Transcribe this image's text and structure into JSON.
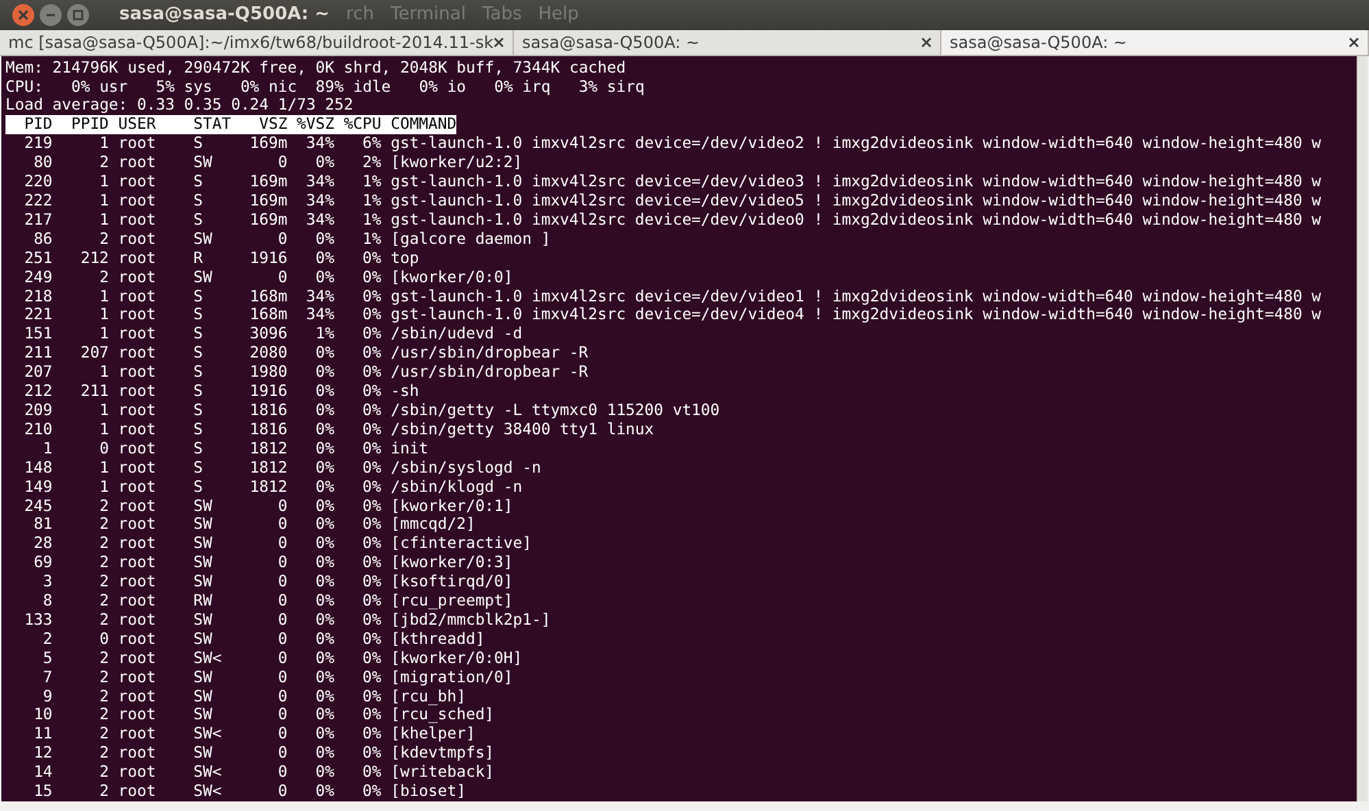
{
  "window": {
    "title": "sasa@sasa-Q500A: ~"
  },
  "menu": [
    "rch",
    "Terminal",
    "Tabs",
    "Help"
  ],
  "tabs": [
    {
      "label": "mc [sasa@sasa-Q500A]:~/imx6/tw68/buildroot-2014.11-sk",
      "selected": false
    },
    {
      "label": "sasa@sasa-Q500A: ~",
      "selected": false
    },
    {
      "label": "sasa@sasa-Q500A: ~",
      "selected": true
    }
  ],
  "summary": [
    "Mem: 214796K used, 290472K free, 0K shrd, 2048K buff, 7344K cached",
    "CPU:   0% usr   5% sys   0% nic  89% idle   0% io   0% irq   3% sirq",
    "Load average: 0.33 0.35 0.24 1/73 252"
  ],
  "table": {
    "columns": [
      "PID",
      "PPID",
      "USER",
      "STAT",
      "VSZ",
      "%VSZ",
      "%CPU",
      "COMMAND"
    ],
    "rows": [
      [
        "219",
        "1",
        "root",
        "S",
        "169m",
        "34%",
        "6%",
        "gst-launch-1.0 imxv4l2src device=/dev/video2 ! imxg2dvideosink window-width=640 window-height=480 w"
      ],
      [
        "80",
        "2",
        "root",
        "SW",
        "0",
        "0%",
        "2%",
        "[kworker/u2:2]"
      ],
      [
        "220",
        "1",
        "root",
        "S",
        "169m",
        "34%",
        "1%",
        "gst-launch-1.0 imxv4l2src device=/dev/video3 ! imxg2dvideosink window-width=640 window-height=480 w"
      ],
      [
        "222",
        "1",
        "root",
        "S",
        "169m",
        "34%",
        "1%",
        "gst-launch-1.0 imxv4l2src device=/dev/video5 ! imxg2dvideosink window-width=640 window-height=480 w"
      ],
      [
        "217",
        "1",
        "root",
        "S",
        "169m",
        "34%",
        "1%",
        "gst-launch-1.0 imxv4l2src device=/dev/video0 ! imxg2dvideosink window-width=640 window-height=480 w"
      ],
      [
        "86",
        "2",
        "root",
        "SW",
        "0",
        "0%",
        "1%",
        "[galcore daemon ]"
      ],
      [
        "251",
        "212",
        "root",
        "R",
        "1916",
        "0%",
        "0%",
        "top"
      ],
      [
        "249",
        "2",
        "root",
        "SW",
        "0",
        "0%",
        "0%",
        "[kworker/0:0]"
      ],
      [
        "218",
        "1",
        "root",
        "S",
        "168m",
        "34%",
        "0%",
        "gst-launch-1.0 imxv4l2src device=/dev/video1 ! imxg2dvideosink window-width=640 window-height=480 w"
      ],
      [
        "221",
        "1",
        "root",
        "S",
        "168m",
        "34%",
        "0%",
        "gst-launch-1.0 imxv4l2src device=/dev/video4 ! imxg2dvideosink window-width=640 window-height=480 w"
      ],
      [
        "151",
        "1",
        "root",
        "S",
        "3096",
        "1%",
        "0%",
        "/sbin/udevd -d"
      ],
      [
        "211",
        "207",
        "root",
        "S",
        "2080",
        "0%",
        "0%",
        "/usr/sbin/dropbear -R"
      ],
      [
        "207",
        "1",
        "root",
        "S",
        "1980",
        "0%",
        "0%",
        "/usr/sbin/dropbear -R"
      ],
      [
        "212",
        "211",
        "root",
        "S",
        "1916",
        "0%",
        "0%",
        "-sh"
      ],
      [
        "209",
        "1",
        "root",
        "S",
        "1816",
        "0%",
        "0%",
        "/sbin/getty -L ttymxc0 115200 vt100"
      ],
      [
        "210",
        "1",
        "root",
        "S",
        "1816",
        "0%",
        "0%",
        "/sbin/getty 38400 tty1 linux"
      ],
      [
        "1",
        "0",
        "root",
        "S",
        "1812",
        "0%",
        "0%",
        "init"
      ],
      [
        "148",
        "1",
        "root",
        "S",
        "1812",
        "0%",
        "0%",
        "/sbin/syslogd -n"
      ],
      [
        "149",
        "1",
        "root",
        "S",
        "1812",
        "0%",
        "0%",
        "/sbin/klogd -n"
      ],
      [
        "245",
        "2",
        "root",
        "SW",
        "0",
        "0%",
        "0%",
        "[kworker/0:1]"
      ],
      [
        "81",
        "2",
        "root",
        "SW",
        "0",
        "0%",
        "0%",
        "[mmcqd/2]"
      ],
      [
        "28",
        "2",
        "root",
        "SW",
        "0",
        "0%",
        "0%",
        "[cfinteractive]"
      ],
      [
        "69",
        "2",
        "root",
        "SW",
        "0",
        "0%",
        "0%",
        "[kworker/0:3]"
      ],
      [
        "3",
        "2",
        "root",
        "SW",
        "0",
        "0%",
        "0%",
        "[ksoftirqd/0]"
      ],
      [
        "8",
        "2",
        "root",
        "RW",
        "0",
        "0%",
        "0%",
        "[rcu_preempt]"
      ],
      [
        "133",
        "2",
        "root",
        "SW",
        "0",
        "0%",
        "0%",
        "[jbd2/mmcblk2p1-]"
      ],
      [
        "2",
        "0",
        "root",
        "SW",
        "0",
        "0%",
        "0%",
        "[kthreadd]"
      ],
      [
        "5",
        "2",
        "root",
        "SW<",
        "0",
        "0%",
        "0%",
        "[kworker/0:0H]"
      ],
      [
        "7",
        "2",
        "root",
        "SW",
        "0",
        "0%",
        "0%",
        "[migration/0]"
      ],
      [
        "9",
        "2",
        "root",
        "SW",
        "0",
        "0%",
        "0%",
        "[rcu_bh]"
      ],
      [
        "10",
        "2",
        "root",
        "SW",
        "0",
        "0%",
        "0%",
        "[rcu_sched]"
      ],
      [
        "11",
        "2",
        "root",
        "SW<",
        "0",
        "0%",
        "0%",
        "[khelper]"
      ],
      [
        "12",
        "2",
        "root",
        "SW",
        "0",
        "0%",
        "0%",
        "[kdevtmpfs]"
      ],
      [
        "14",
        "2",
        "root",
        "SW<",
        "0",
        "0%",
        "0%",
        "[writeback]"
      ],
      [
        "15",
        "2",
        "root",
        "SW<",
        "0",
        "0%",
        "0%",
        "[bioset]"
      ]
    ]
  }
}
